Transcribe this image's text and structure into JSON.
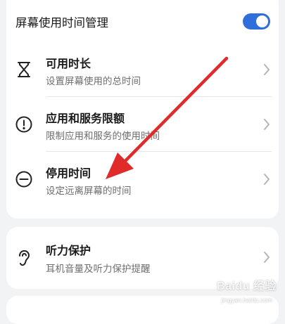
{
  "header": {
    "title": "屏幕使用时间管理",
    "toggle_on": true,
    "accent_color": "#2f6fdb"
  },
  "items": [
    {
      "title": "可用时长",
      "subtitle": "设置屏幕使用的总时间",
      "icon": "hourglass-icon"
    },
    {
      "title": "应用和服务限额",
      "subtitle": "限制应用和服务的使用时间",
      "icon": "exclamation-circle-icon"
    },
    {
      "title": "停用时间",
      "subtitle": "设定远离屏幕的时间",
      "icon": "minus-circle-icon"
    }
  ],
  "hearing": {
    "title": "听力保护",
    "subtitle": "耳机音量及听力保护提醒",
    "icon": "ear-icon"
  },
  "annotation": {
    "arrow_color": "#e02b2b"
  },
  "watermark": {
    "brand": "Baidu 经验",
    "url": "jingyan.baidu.com"
  }
}
